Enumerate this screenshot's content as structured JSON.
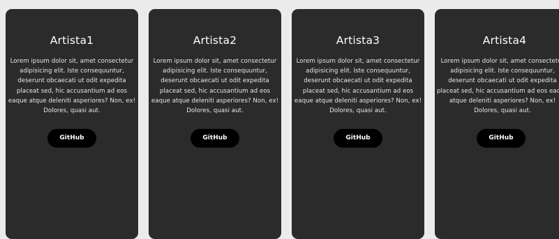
{
  "cards": [
    {
      "title": "Artista1",
      "description": "Lorem ipsum dolor sit, amet consectetur adipisicing elit. Iste consequuntur, deserunt obcaecati ut odit expedita placeat sed, hic accusantium ad eos eaque atque deleniti asperiores? Non, ex! Dolores, quasi aut.",
      "button_label": "GitHub"
    },
    {
      "title": "Artista2",
      "description": "Lorem ipsum dolor sit, amet consectetur adipisicing elit. Iste consequuntur, deserunt obcaecati ut odit expedita placeat sed, hic accusantium ad eos eaque atque deleniti asperiores? Non, ex! Dolores, quasi aut.",
      "button_label": "GitHub"
    },
    {
      "title": "Artista3",
      "description": "Lorem ipsum dolor sit, amet consectetur adipisicing elit. Iste consequuntur, deserunt obcaecati ut odit expedita placeat sed, hic accusantium ad eos eaque atque deleniti asperiores? Non, ex! Dolores, quasi aut.",
      "button_label": "GitHub"
    },
    {
      "title": "Artista4",
      "description": "Lorem ipsum dolor sit, amet consectetur adipisicing elit. Iste consequuntur, deserunt obcaecati ut odit expedita placeat sed, hic accusantium ad eos eaque atque deleniti asperiores? Non, ex! Dolores, quasi aut.",
      "button_label": "GitHub"
    }
  ],
  "colors": {
    "page_background": "#ebebeb",
    "card_background": "#2b2b2b",
    "button_background": "#000000",
    "text": "#ffffff"
  }
}
